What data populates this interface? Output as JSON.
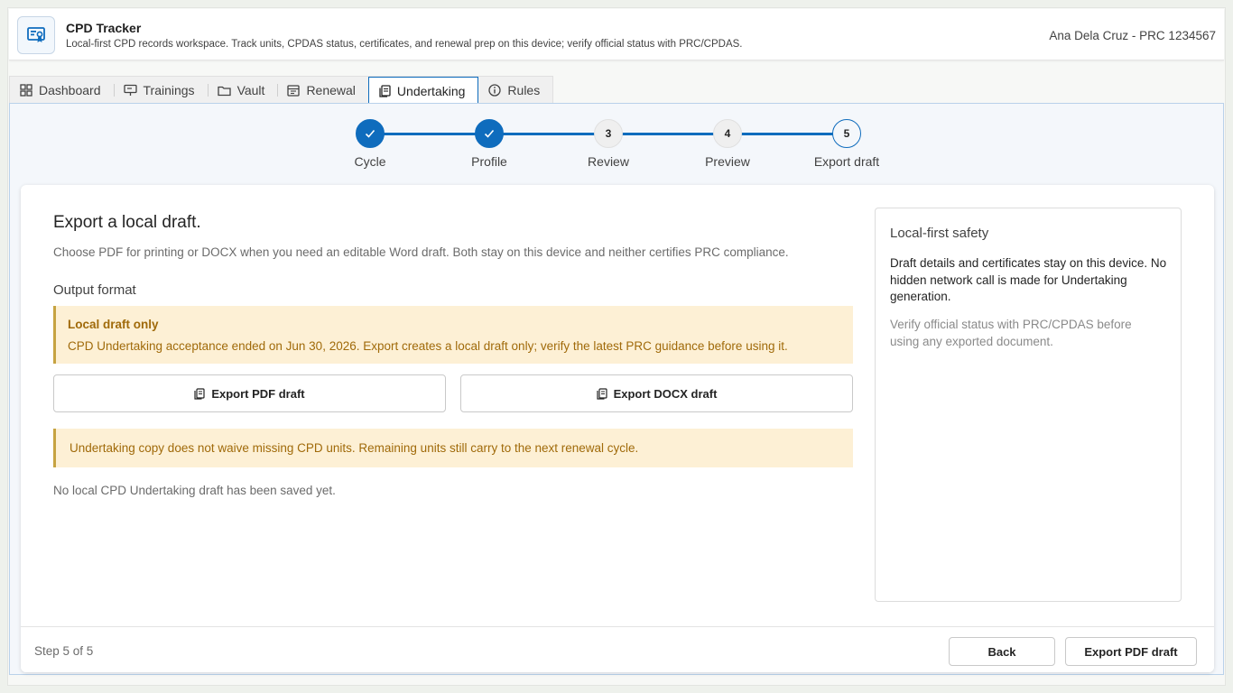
{
  "header": {
    "title": "CPD Tracker",
    "subtitle": "Local-first CPD records workspace. Track units, CPDAS status, certificates, and renewal prep on this device; verify official status with PRC/CPDAS.",
    "user": "Ana Dela Cruz - PRC 1234567",
    "icon": "certificate-icon"
  },
  "tabs": [
    {
      "label": "Dashboard",
      "icon": "grid-icon",
      "active": false
    },
    {
      "label": "Trainings",
      "icon": "presentation-icon",
      "active": false
    },
    {
      "label": "Vault",
      "icon": "folder-icon",
      "active": false
    },
    {
      "label": "Renewal",
      "icon": "calendar-icon",
      "active": false
    },
    {
      "label": "Undertaking",
      "icon": "document-icon",
      "active": true
    },
    {
      "label": "Rules",
      "icon": "info-icon",
      "active": false
    }
  ],
  "stepper": {
    "steps": [
      {
        "number": "1",
        "label": "Cycle",
        "status": "done"
      },
      {
        "number": "2",
        "label": "Profile",
        "status": "done"
      },
      {
        "number": "3",
        "label": "Review",
        "status": "pending"
      },
      {
        "number": "4",
        "label": "Preview",
        "status": "pending"
      },
      {
        "number": "5",
        "label": "Export draft",
        "status": "current"
      }
    ],
    "accent_color": "#0f6cbd"
  },
  "main": {
    "title": "Export a local draft.",
    "description": "Choose PDF for printing or DOCX when you need an editable Word draft. Both stay on this device and neither certifies PRC compliance.",
    "output_format_label": "Output format",
    "warning": {
      "title": "Local draft only",
      "text": "CPD Undertaking acceptance ended on Jun 30, 2026. Export creates a local draft only; verify the latest PRC guidance before using it."
    },
    "export_pdf_label": "Export PDF draft",
    "export_docx_label": "Export DOCX draft",
    "note": "Undertaking copy does not waive missing CPD units. Remaining units still carry to the next renewal cycle.",
    "empty_state": "No local CPD Undertaking draft has been saved yet."
  },
  "side": {
    "title": "Local-first safety",
    "body": "Draft details and certificates stay on this device. No hidden network call is made for Undertaking generation.",
    "muted": "Verify official status with PRC/CPDAS before using any exported document."
  },
  "footer": {
    "step_text": "Step 5 of 5",
    "back_label": "Back",
    "primary_label": "Export PDF draft"
  },
  "colors": {
    "accent": "#0f6cbd",
    "warning_bg": "#fdf0d5",
    "warning_text": "#a06a0a"
  }
}
